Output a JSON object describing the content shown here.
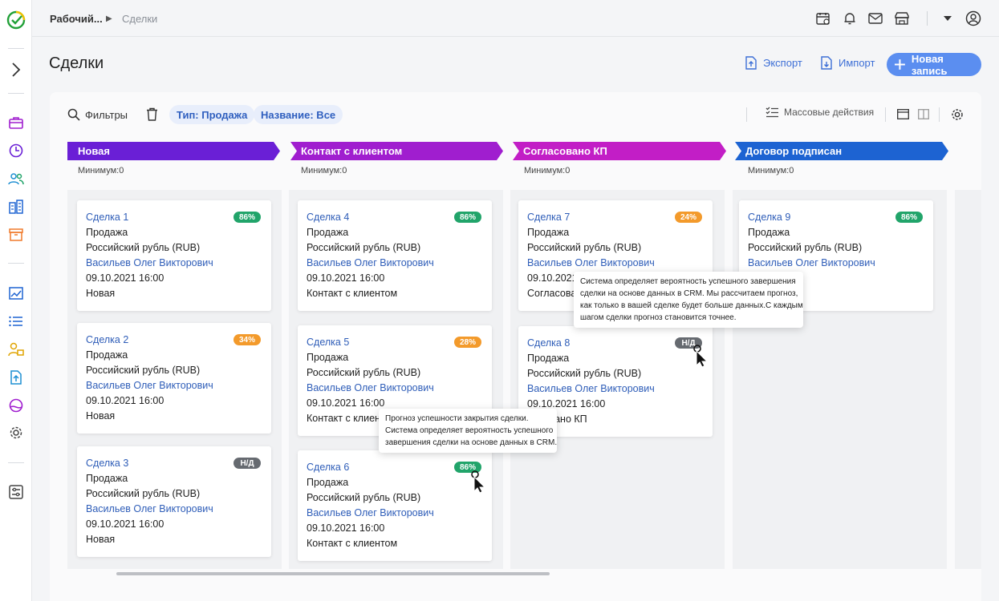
{
  "colors": {
    "accent": "#5b8ef0",
    "link": "#2e5db8",
    "badge_green": "#21a46a",
    "badge_orange": "#f39a2b",
    "badge_gray": "#666a70",
    "stage_new": "#6a1fd6",
    "stage_contact": "#a01ecf",
    "stage_agreed": "#c21ec6",
    "stage_signed": "#1d63d2"
  },
  "header": {
    "breadcrumb": [
      "Рабочий...",
      "Сделки"
    ],
    "title": "Сделки",
    "export_label": "Экспорт",
    "import_label": "Импорт",
    "new_record_label": "Новая запись"
  },
  "filters": {
    "filters_label": "Фильтры",
    "chip_type": "Тип: Продажа",
    "chip_name": "Название: Все",
    "mass_actions_label": "Массовые действия"
  },
  "stages": [
    {
      "name": "Новая",
      "min": "Минимум:0"
    },
    {
      "name": "Контакт с клиентом",
      "min": "Минимум:0"
    },
    {
      "name": "Согласовано КП",
      "min": "Минимум:0"
    },
    {
      "name": "Договор подписан",
      "min": "Минимум:0"
    }
  ],
  "cards": [
    {
      "title": "Сделка 1",
      "badge": "86%",
      "type": "Продажа",
      "currency": "Российский рубль (RUB)",
      "owner": "Васильев Олег Викторович",
      "date": "09.10.2021 16:00",
      "stage": "Новая"
    },
    {
      "title": "Сделка 2",
      "badge": "34%",
      "type": "Продажа",
      "currency": "Российский рубль (RUB)",
      "owner": "Васильев Олег Викторович",
      "date": "09.10.2021 16:00",
      "stage": "Новая"
    },
    {
      "title": "Сделка 3",
      "badge": "Н/Д",
      "type": "Продажа",
      "currency": "Российский рубль (RUB)",
      "owner": "Васильев Олег Викторович",
      "date": "09.10.2021 16:00",
      "stage": "Новая"
    },
    {
      "title": "Сделка 4",
      "badge": "86%",
      "type": "Продажа",
      "currency": "Российский рубль (RUB)",
      "owner": "Васильев Олег Викторович",
      "date": "09.10.2021 16:00",
      "stage": "Контакт с клиентом"
    },
    {
      "title": "Сделка 5",
      "badge": "28%",
      "type": "Продажа",
      "currency": "Российский рубль (RUB)",
      "owner": "Васильев Олег Викторович",
      "date": "09.10.2021 16:00",
      "stage": "Контакт с клиент"
    },
    {
      "title": "Сделка 6",
      "badge": "86%",
      "type": "Продажа",
      "currency": "Российский рубль (RUB)",
      "owner": "Васильев Олег Викторович",
      "date": "09.10.2021 16:00",
      "stage": "Контакт с клиентом"
    },
    {
      "title": "Сделка 7",
      "badge": "24%",
      "type": "Продажа",
      "currency": "Российский рубль (RUB)",
      "owner": "Васильев Олег Викторович",
      "date": "09.10.2021",
      "stage": "Согласова"
    },
    {
      "title": "Сделка 8",
      "badge": "Н/Д",
      "type": "Продажа",
      "currency": "Российский рубль (RUB)",
      "owner": "Васильев Олег Викторович",
      "date": "09.10.2021 16:00",
      "stage": "ласовано КП"
    },
    {
      "title": "Сделка 9",
      "badge": "86%",
      "type": "Продажа",
      "currency": "Российский рубль (RUB)",
      "owner": "Васильев Олег Викторович",
      "date": "6:00",
      "stage": "исан"
    }
  ],
  "tooltips": {
    "crm_forecast": [
      "Система определяет вероятность успешного завершения",
      "сделки на основе данных в CRM. Мы рассчитаем прогноз,",
      "как только в вашей сделке будет больше данных.С каждым",
      "шагом сделки прогноз становится точнее."
    ],
    "success_forecast": [
      "Прогноз успешности закрытия сделки.",
      "Система определяет вероятность успешного",
      "завершения сделки на основе данных в CRM."
    ]
  },
  "icons": {
    "sidebar": [
      "logo-icon",
      "expand-icon",
      "briefcase-icon",
      "clock-icon",
      "users-icon",
      "buildings-icon",
      "archive-icon",
      "chart-icon",
      "list-icon",
      "user-lock-icon",
      "document-upload-icon",
      "globe-icon",
      "gear-icon",
      "settings-sliders-icon"
    ],
    "top": [
      "calendar-icon",
      "bell-icon",
      "mail-icon",
      "store-icon",
      "caret-down-icon",
      "profile-icon"
    ]
  }
}
